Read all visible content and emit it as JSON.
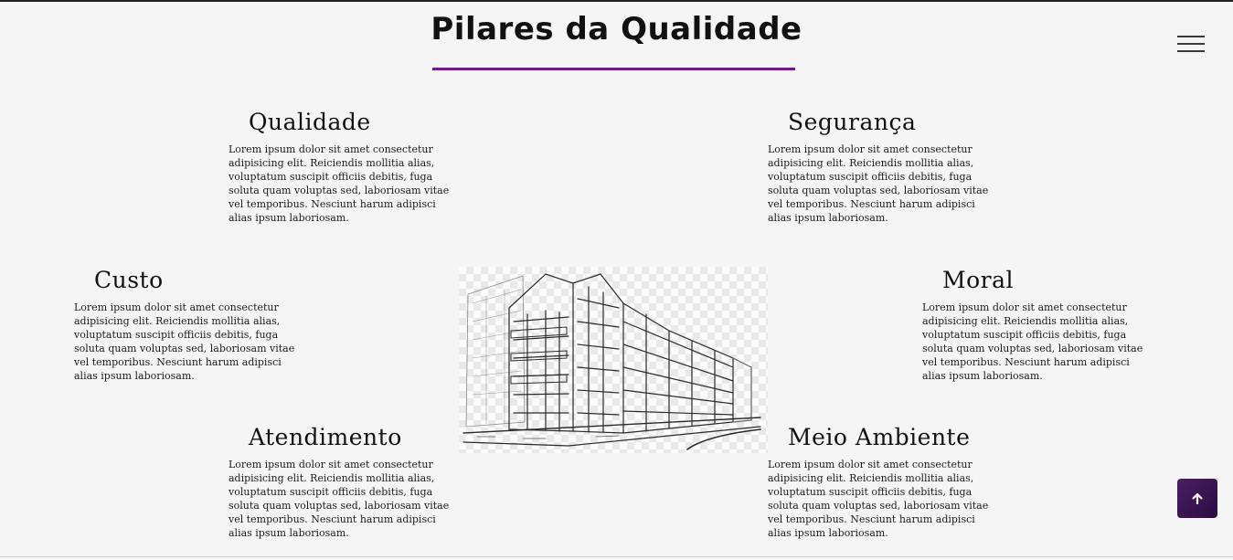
{
  "header": {
    "title": "Pilares da Qualidade",
    "underline_color": "#6d1b86",
    "menu_icon": "hamburger-menu-icon"
  },
  "pillars": [
    {
      "title": "Qualidade",
      "text": "Lorem ipsum dolor sit amet consectetur adipisicing elit. Reiciendis mollitia alias, voluptatum suscipit officiis debitis, fuga soluta quam voluptas sed, laboriosam vitae vel temporibus. Nesciunt harum adipisci alias ipsum laboriosam."
    },
    {
      "title": "Segurança",
      "text": "Lorem ipsum dolor sit amet consectetur adipisicing elit. Reiciendis mollitia alias, voluptatum suscipit officiis debitis, fuga soluta quam voluptas sed, laboriosam vitae vel temporibus. Nesciunt harum adipisci alias ipsum laboriosam."
    },
    {
      "title": "Custo",
      "text": "Lorem ipsum dolor sit amet consectetur adipisicing elit. Reiciendis mollitia alias, voluptatum suscipit officiis debitis, fuga soluta quam voluptas sed, laboriosam vitae vel temporibus. Nesciunt harum adipisci alias ipsum laboriosam."
    },
    {
      "title": "Moral",
      "text": "Lorem ipsum dolor sit amet consectetur adipisicing elit. Reiciendis mollitia alias, voluptatum suscipit officiis debitis, fuga soluta quam voluptas sed, laboriosam vitae vel temporibus. Nesciunt harum adipisci alias ipsum laboriosam."
    },
    {
      "title": "Atendimento",
      "text": "Lorem ipsum dolor sit amet consectetur adipisicing elit. Reiciendis mollitia alias, voluptatum suscipit officiis debitis, fuga soluta quam voluptas sed, laboriosam vitae vel temporibus. Nesciunt harum adipisci alias ipsum laboriosam."
    },
    {
      "title": "Meio Ambiente",
      "text": "Lorem ipsum dolor sit amet consectetur adipisicing elit. Reiciendis mollitia alias, voluptatum suscipit officiis debitis, fuga soluta quam voluptas sed, laboriosam vitae vel temporibus. Nesciunt harum adipisci alias ipsum laboriosam."
    }
  ],
  "illustration": {
    "subject": "building-sketch"
  },
  "scroll_top": {
    "icon": "arrow-up-icon",
    "color": "#3b1552"
  }
}
